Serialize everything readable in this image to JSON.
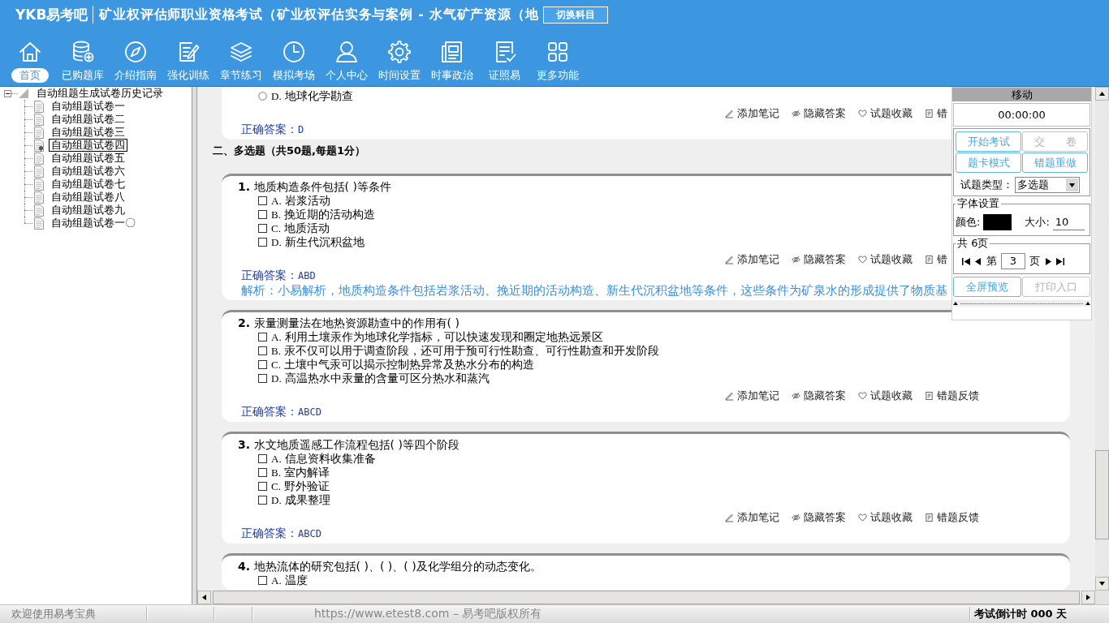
{
  "header": {
    "logo": "YKB易考吧",
    "title": "矿业权评估师职业资格考试（矿业权评估实务与案例 - 水气矿产资源（地",
    "switch_button": "切换科目"
  },
  "nav": [
    {
      "kind": "home",
      "label": "首页",
      "selected": true
    },
    {
      "kind": "library",
      "label": "已购题库",
      "selected": false
    },
    {
      "kind": "guide",
      "label": "介绍指南",
      "selected": false
    },
    {
      "kind": "training",
      "label": "强化训练",
      "selected": false
    },
    {
      "kind": "chapter",
      "label": "章节练习",
      "selected": false
    },
    {
      "kind": "exam",
      "label": "模拟考场",
      "selected": false
    },
    {
      "kind": "user",
      "label": "个人中心",
      "selected": false
    },
    {
      "kind": "settings",
      "label": "时间设置",
      "selected": false
    },
    {
      "kind": "news",
      "label": "时事政治",
      "selected": false
    },
    {
      "kind": "certificate",
      "label": "证照易",
      "selected": false
    },
    {
      "kind": "more",
      "label": "更多功能",
      "selected": false
    }
  ],
  "tree": {
    "label": "自动组题生成试卷历史记录",
    "expanded": true,
    "children": [
      {
        "label": "自动组题试卷一",
        "selected": false
      },
      {
        "label": "自动组题试卷二",
        "selected": false
      },
      {
        "label": "自动组题试卷三",
        "selected": false
      },
      {
        "label": "自动组题试卷四",
        "selected": true
      },
      {
        "label": "自动组题试卷五",
        "selected": false
      },
      {
        "label": "自动组题试卷六",
        "selected": false
      },
      {
        "label": "自动组题试卷七",
        "selected": false
      },
      {
        "label": "自动组题试卷八",
        "selected": false
      },
      {
        "label": "自动组题试卷九",
        "selected": false
      },
      {
        "label": "自动组题试卷一〇",
        "selected": false
      }
    ]
  },
  "content": [
    {
      "kind": "question",
      "options": [
        {
          "kind": "radio",
          "letter": "D.",
          "text": "地球化学勘查",
          "checked": false
        }
      ],
      "actions": [
        {
          "kind": "note",
          "label": "添加笔记"
        },
        {
          "kind": "hide",
          "label": "隐藏答案"
        },
        {
          "kind": "favorite",
          "label": "试题收藏"
        },
        {
          "kind": "feedback",
          "label": "错"
        }
      ],
      "answer": {
        "label": "正确答案：",
        "value": "D"
      }
    },
    {
      "kind": "heading",
      "text": "二、多选题（共50题,每题1分）"
    },
    {
      "kind": "question",
      "number": "1.",
      "stem": "地质构造条件包括( )等条件",
      "options": [
        {
          "kind": "checkbox",
          "letter": "A.",
          "text": "岩浆活动",
          "checked": false
        },
        {
          "kind": "checkbox",
          "letter": "B.",
          "text": "挽近期的活动构造",
          "checked": false
        },
        {
          "kind": "checkbox",
          "letter": "C.",
          "text": "地质活动",
          "checked": false
        },
        {
          "kind": "checkbox",
          "letter": "D.",
          "text": "新生代沉积盆地",
          "checked": false
        }
      ],
      "actions": [
        {
          "kind": "note",
          "label": "添加笔记"
        },
        {
          "kind": "hide",
          "label": "隐藏答案"
        },
        {
          "kind": "favorite",
          "label": "试题收藏"
        },
        {
          "kind": "feedback",
          "label": "错"
        }
      ],
      "answer": {
        "label": "正确答案：",
        "value": "ABD"
      },
      "analysis": "解析：小易解析，地质构造条件包括岩浆活动、挽近期的活动构造、新生代沉积盆地等条件，这些条件为矿泉水的形成提供了物质基"
    },
    {
      "kind": "question",
      "number": "2.",
      "stem": "汞量测量法在地热资源勘查中的作用有( )",
      "options": [
        {
          "kind": "checkbox",
          "letter": "A.",
          "text": "利用土壤汞作为地球化学指标，可以快速发现和圈定地热远景区",
          "checked": false
        },
        {
          "kind": "checkbox",
          "letter": "B.",
          "text": "汞不仅可以用于调查阶段，还可用于预可行性勘查、可行性勘查和开发阶段",
          "checked": false
        },
        {
          "kind": "checkbox",
          "letter": "C.",
          "text": "土壤中气汞可以揭示控制热异常及热水分布的构造",
          "checked": false
        },
        {
          "kind": "checkbox",
          "letter": "D.",
          "text": "高温热水中汞量的含量可区分热水和蒸汽",
          "checked": false
        }
      ],
      "actions": [
        {
          "kind": "note",
          "label": "添加笔记"
        },
        {
          "kind": "hide",
          "label": "隐藏答案"
        },
        {
          "kind": "favorite",
          "label": "试题收藏"
        },
        {
          "kind": "feedback",
          "label": "错题反馈"
        }
      ],
      "answer": {
        "label": "正确答案：",
        "value": "ABCD"
      }
    },
    {
      "kind": "question",
      "number": "3.",
      "stem": "水文地质遥感工作流程包括( )等四个阶段",
      "options": [
        {
          "kind": "checkbox",
          "letter": "A.",
          "text": "信息资料收集准备",
          "checked": false
        },
        {
          "kind": "checkbox",
          "letter": "B.",
          "text": "室内解译",
          "checked": false
        },
        {
          "kind": "checkbox",
          "letter": "C.",
          "text": "野外验证",
          "checked": false
        },
        {
          "kind": "checkbox",
          "letter": "D.",
          "text": "成果整理",
          "checked": false
        }
      ],
      "actions": [
        {
          "kind": "note",
          "label": "添加笔记"
        },
        {
          "kind": "hide",
          "label": "隐藏答案"
        },
        {
          "kind": "favorite",
          "label": "试题收藏"
        },
        {
          "kind": "feedback",
          "label": "错题反馈"
        }
      ],
      "answer": {
        "label": "正确答案：",
        "value": "ABCD"
      }
    },
    {
      "kind": "question",
      "number": "4.",
      "stem": "地热流体的研究包括( )、( )、( )及化学组分的动态变化。",
      "options": [
        {
          "kind": "checkbox",
          "letter": "A.",
          "text": "温度",
          "checked": false
        }
      ]
    }
  ],
  "panel": {
    "title": "移动",
    "timer": "00:00:00",
    "buttons": [
      {
        "label": "开始考试",
        "disabled": false
      },
      {
        "label": "交　　卷",
        "disabled": true
      },
      {
        "label": "题卡模式",
        "disabled": false
      },
      {
        "label": "错题重做",
        "disabled": false
      }
    ],
    "type_label": "试题类型：",
    "type_value": "多选题",
    "font_settings": {
      "legend": "字体设置",
      "color_label": "颜色:",
      "color": "#000000",
      "size_label": "大小:",
      "size": "10"
    },
    "pager": {
      "legend": "共 6页",
      "prefix": "第",
      "page": "3",
      "suffix": "页"
    },
    "bottom_buttons": [
      {
        "label": "全屏预览",
        "disabled": false
      },
      {
        "label": "打印入口",
        "disabled": true
      }
    ]
  },
  "status_bar": {
    "welcome": "欢迎使用易考宝典",
    "copyright": "https://www.etest8.com – 易考吧版权所有",
    "countdown": "考试倒计时 000 天"
  }
}
